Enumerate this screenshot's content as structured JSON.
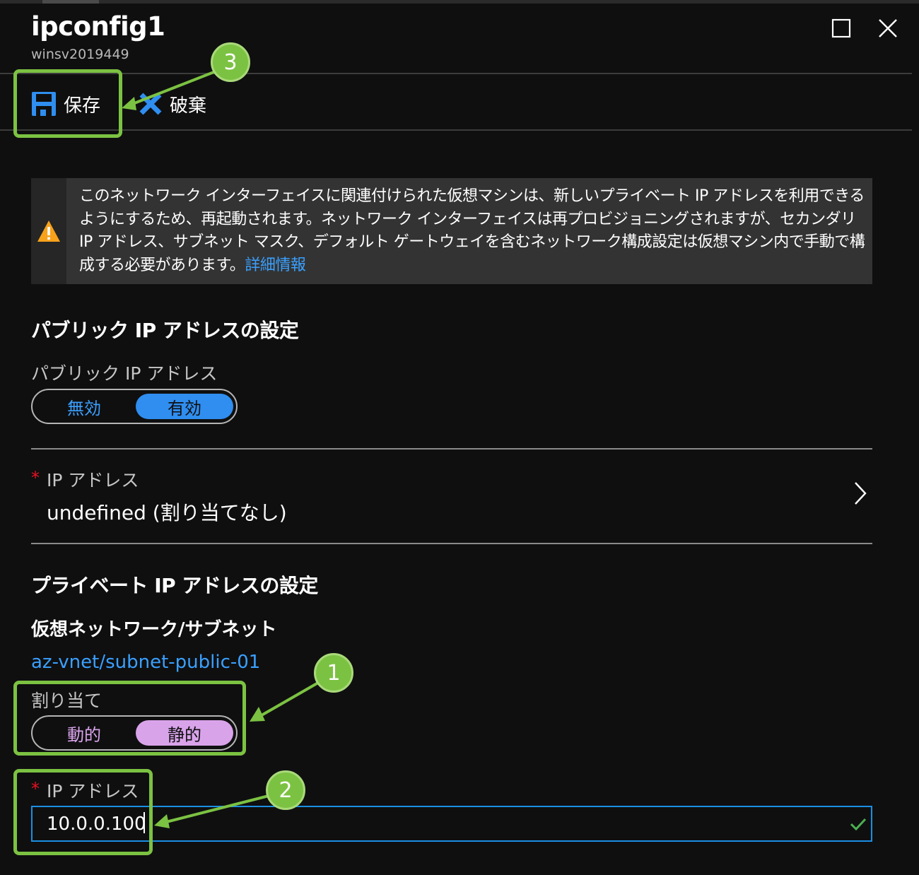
{
  "blade": {
    "title": "ipconfig1",
    "subtitle": "winsv2019449"
  },
  "window_controls": {
    "maximize_icon": "square-icon",
    "close_icon": "close-x-icon"
  },
  "toolbar": {
    "save_label": "保存",
    "save_icon": "floppy-disk-icon",
    "discard_label": "破棄",
    "discard_icon": "x-icon"
  },
  "warning": {
    "icon": "warning-triangle-icon",
    "text": "このネットワーク インターフェイスに関連付けられた仮想マシンは、新しいプライベート IP アドレスを利用できるようにするため、再起動されます。ネットワーク インターフェイスは再プロビジョニングされますが、セカンダリ IP アドレス、サブネット マスク、デフォルト ゲートウェイを含むネットワーク構成設定は仮想マシン内で手動で構成する必要があります。",
    "link": "詳細情報"
  },
  "public_ip": {
    "section_title": "パブリック IP アドレスの設定",
    "toggle_label": "パブリック IP アドレス",
    "options": [
      "無効",
      "有効"
    ],
    "selected": "有効",
    "address_label": "IP アドレス",
    "address_required_mark": "*",
    "address_value": "undefined (割り当てなし)"
  },
  "private_ip": {
    "section_title": "プライベート IP アドレスの設定",
    "vnet_label": "仮想ネットワーク/サブネット",
    "vnet_value": "az-vnet/subnet-public-01",
    "assignment_label": "割り当て",
    "assignment_options": [
      "動的",
      "静的"
    ],
    "assignment_selected": "静的",
    "ip_label": "IP アドレス",
    "ip_required_mark": "*",
    "ip_value": "10.0.0.100"
  },
  "annotations": [
    "1",
    "2",
    "3"
  ],
  "colors": {
    "accent_blue": "#1a8fe3",
    "link_blue": "#3aa0ff",
    "toggle_blue": "#2f8ef0",
    "toggle_pink": "#d9a3ea",
    "annotation_green": "#7cc242",
    "warning_orange": "#f7a21b",
    "valid_green": "#4caf50"
  }
}
